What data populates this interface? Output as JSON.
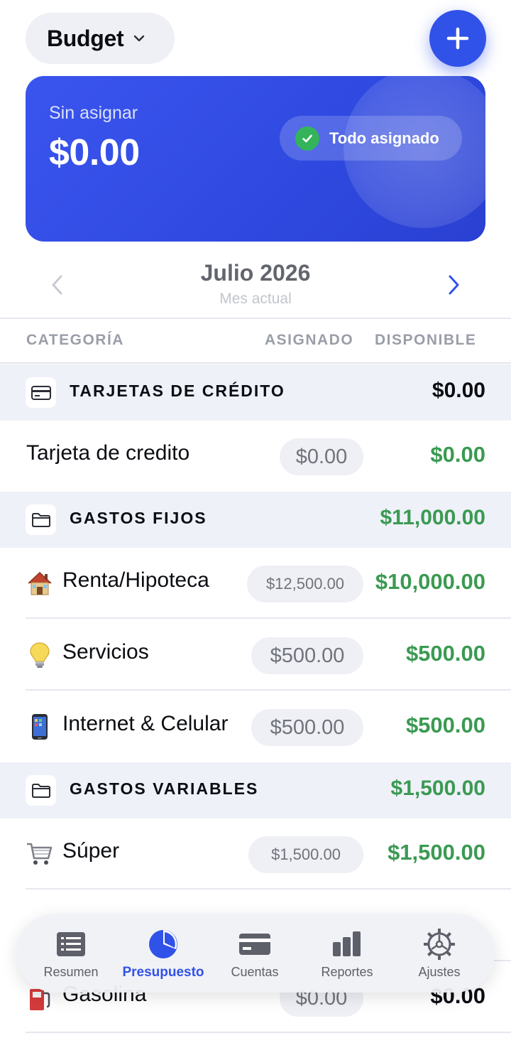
{
  "header": {
    "budget_label": "Budget"
  },
  "hero": {
    "subtitle": "Sin asignar",
    "amount": "$0.00",
    "chip_label": "Todo asignado"
  },
  "month": {
    "title": "Julio 2026",
    "subtitle": "Mes actual"
  },
  "columns": {
    "category": "CATEGORÍA",
    "assigned": "ASIGNADO",
    "available": "DISPONIBLE"
  },
  "groups": [
    {
      "name": "TARJETAS DE CRÉDITO",
      "value": "$0.00",
      "icon": "credit-card-icon"
    },
    {
      "name": "GASTOS FIJOS",
      "value": "$11,000.00",
      "icon": "folder-icon"
    },
    {
      "name": "GASTOS VARIABLES",
      "value": "$1,500.00",
      "icon": "folder-icon"
    }
  ],
  "items": [
    {
      "name": "Tarjeta de credito",
      "assigned": "$0.00",
      "available": "$0.00",
      "icon": ""
    },
    {
      "name": "Renta/Hipoteca",
      "assigned": "$12,500.00",
      "available": "$10,000.00",
      "icon": "house-icon"
    },
    {
      "name": "Servicios",
      "assigned": "$500.00",
      "available": "$500.00",
      "icon": "lightbulb-icon"
    },
    {
      "name": "Internet & Celular",
      "assigned": "$500.00",
      "available": "$500.00",
      "icon": "phone-icon"
    },
    {
      "name": "Súper",
      "assigned": "$1,500.00",
      "available": "$1,500.00",
      "icon": "cart-icon"
    },
    {
      "name": "Gasolina",
      "assigned": "$0.00",
      "available": "$0.00",
      "icon": "fuel-icon"
    }
  ],
  "tabs": [
    {
      "label": "Resumen",
      "icon": "list-icon"
    },
    {
      "label": "Presupuesto",
      "icon": "pie-chart-icon",
      "active": true
    },
    {
      "label": "Cuentas",
      "icon": "card-icon"
    },
    {
      "label": "Reportes",
      "icon": "bar-chart-icon"
    },
    {
      "label": "Ajustes",
      "icon": "gear-icon"
    }
  ],
  "colors": {
    "accent": "#3152e8",
    "green": "#3a9a52",
    "group_bg": "#eef1f8"
  }
}
